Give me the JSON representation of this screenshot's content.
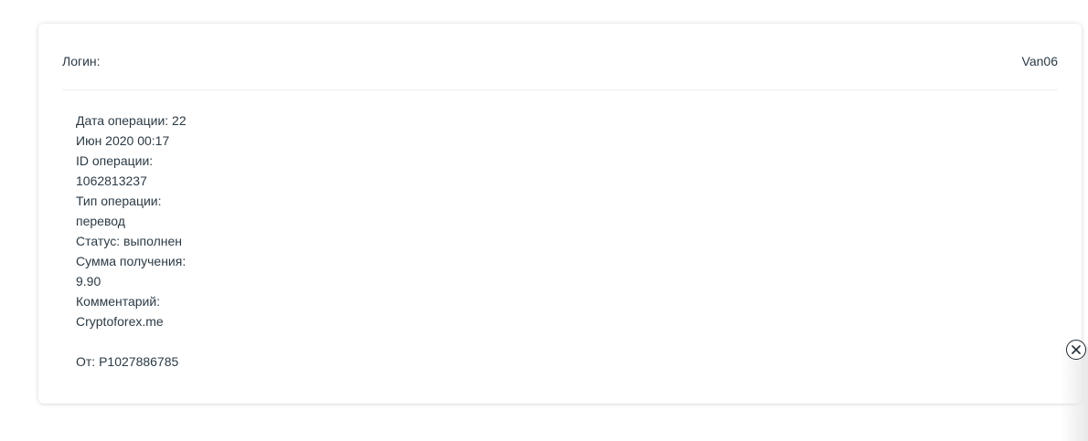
{
  "login": {
    "label": "Логин:",
    "value": "Van06"
  },
  "operation": {
    "lines": [
      "Дата операции: 22",
      "Июн 2020 00:17",
      "ID операции:",
      "1062813237",
      "Тип операции:",
      "перевод",
      "Статус: выполнен",
      "Сумма получения:",
      "9.90",
      "Комментарий:",
      "Cryptoforex.me"
    ],
    "from": "От: P1027886785"
  },
  "icons": {
    "close": "close-circle-icon"
  }
}
